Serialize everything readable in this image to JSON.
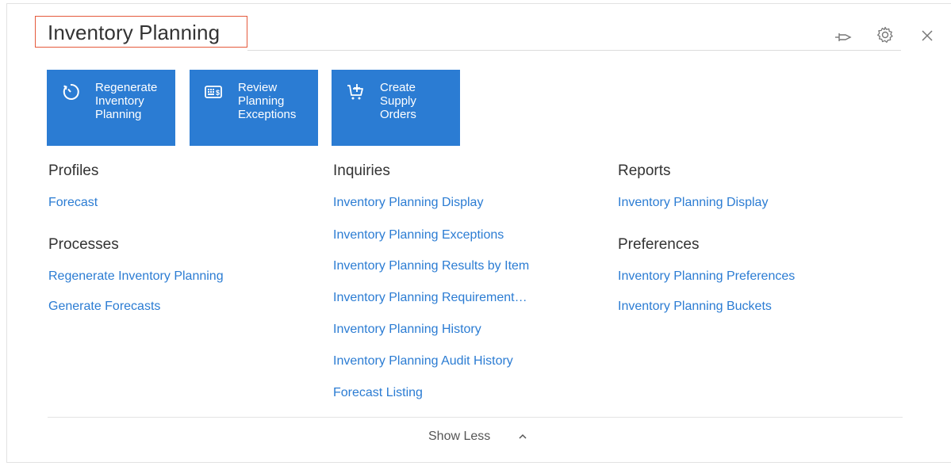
{
  "header": {
    "title": "Inventory Planning",
    "icons": [
      "pin-icon",
      "gear-icon",
      "close-icon"
    ]
  },
  "tiles": [
    {
      "label": "Regenerate\nInventory\nPlanning",
      "icon": "refresh-timer-icon"
    },
    {
      "label": "Review\nPlanning\nExceptions",
      "icon": "keyboard-dollar-icon"
    },
    {
      "label": "Create\nSupply\nOrders",
      "icon": "cart-plus-icon"
    }
  ],
  "profiles": {
    "title": "Profiles",
    "links": [
      "Forecast"
    ]
  },
  "processes": {
    "title": "Processes",
    "links": [
      "Regenerate Inventory Planning",
      "Generate Forecasts"
    ]
  },
  "inquiries": {
    "title": "Inquiries",
    "links": [
      "Inventory Planning Display",
      "Inventory Planning Exceptions",
      "Inventory Planning Results by Item",
      "Inventory Planning Requirement…",
      "Inventory Planning History",
      "Inventory Planning Audit History",
      "Forecast Listing"
    ]
  },
  "reports": {
    "title": "Reports",
    "links": [
      "Inventory Planning Display"
    ]
  },
  "preferences": {
    "title": "Preferences",
    "links": [
      "Inventory Planning Preferences",
      "Inventory Planning Buckets"
    ]
  },
  "footer": {
    "show_less": "Show Less"
  },
  "colors": {
    "accent": "#2b7cd3",
    "title_highlight": "#e55a3c"
  }
}
